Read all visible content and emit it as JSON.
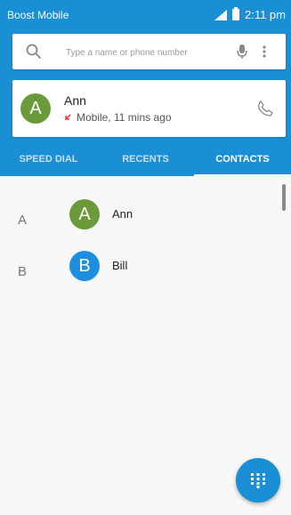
{
  "status_bar": {
    "carrier": "Boost Mobile",
    "time": "2:11 pm"
  },
  "search": {
    "placeholder": "Type a name or phone number",
    "icon": "search-icon",
    "voice_icon": "mic-icon",
    "more_icon": "more-vert-icon"
  },
  "recent_call": {
    "avatar_letter": "A",
    "name": "Ann",
    "detail": "Mobile, 11 mins ago",
    "call_type_icon": "missed-call-icon",
    "call_icon": "phone-icon"
  },
  "tabs": [
    {
      "label": "SPEED DIAL"
    },
    {
      "label": "RECENTS"
    },
    {
      "label": "CONTACTS",
      "active": true
    }
  ],
  "contacts": [
    {
      "section": "A",
      "avatar_letter": "A",
      "name": "Ann",
      "avatar_color": "#6a9a3a"
    },
    {
      "section": "B",
      "avatar_letter": "B",
      "name": "Bill",
      "avatar_color": "#1e8fe0"
    }
  ],
  "fab": {
    "icon": "dialpad-icon"
  },
  "colors": {
    "primary": "#1a8fd6",
    "accent_missed": "#e53935"
  }
}
